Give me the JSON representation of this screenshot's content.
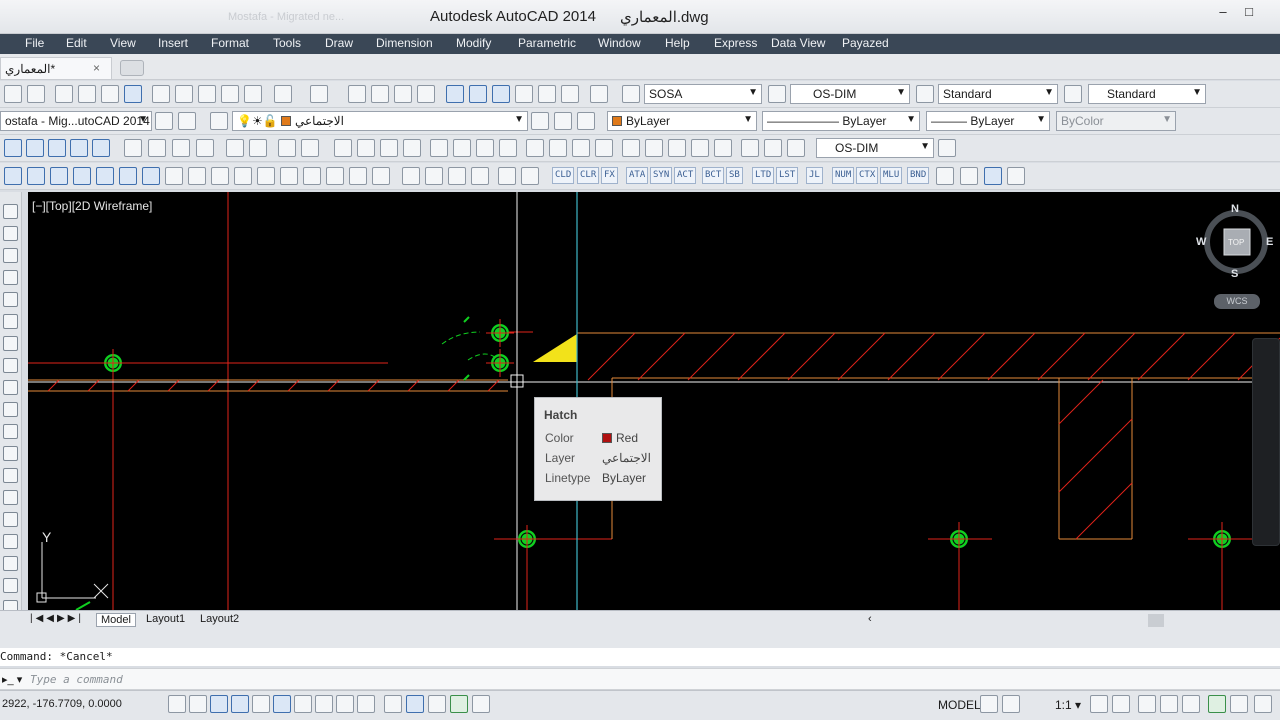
{
  "window": {
    "app_title": "Autodesk AutoCAD 2014",
    "file_name": "المعماري.dwg",
    "ghost_title": "Mostafa - Migrated ne...",
    "minimize": "–",
    "maximize": "□"
  },
  "menu": [
    "File",
    "Edit",
    "View",
    "Insert",
    "Format",
    "Tools",
    "Draw",
    "Dimension",
    "Modify",
    "Parametric",
    "Window",
    "Help",
    "Express",
    "Data View",
    "Payazed"
  ],
  "doc_tab": {
    "label": "المعماري*",
    "close": "×"
  },
  "styles": {
    "text_style": "SOSA",
    "dim_style": "OS-DIM",
    "table_style": "Standard",
    "multileader_style": "Standard",
    "dim_style_2": "OS-DIM"
  },
  "workspace": {
    "label": "ostafa - Mig...utoCAD 2014"
  },
  "layer": {
    "current": "الاجتماعي",
    "swatch_color": "#e07a1a"
  },
  "properties": {
    "color": "ByLayer",
    "color_swatch": "#e07a1a",
    "linetype": "ByLayer",
    "lineweight": "ByLayer",
    "plotstyle": "ByColor"
  },
  "express_chips": [
    "CLD",
    "CLR",
    "FX",
    "ATA",
    "SYN",
    "ACT",
    "BCT",
    "SB",
    "LTD",
    "LST",
    "JL",
    "NUM",
    "CTX",
    "MLU",
    "BND"
  ],
  "viewport": {
    "label": "[−][Top][2D Wireframe]"
  },
  "viewcube": {
    "north": "N",
    "south": "S",
    "east": "E",
    "west": "W",
    "top": "TOP",
    "wcs": "WCS"
  },
  "ucs": {
    "y": "Y"
  },
  "tooltip": {
    "title": "Hatch",
    "rows": [
      {
        "key": "Color",
        "value": "Red",
        "swatch": "#b01010"
      },
      {
        "key": "Layer",
        "value": "الاجتماعي"
      },
      {
        "key": "Linetype",
        "value": "ByLayer"
      }
    ]
  },
  "layout_tabs": [
    "Model",
    "Layout1",
    "Layout2"
  ],
  "command": {
    "history": "Command: *Cancel*",
    "placeholder": "Type a command"
  },
  "status": {
    "coords": "2922, -176.7709, 0.0000",
    "model": "MODEL",
    "scale": "1:1"
  },
  "colors": {
    "canvas": "#000000",
    "red_line": "#e0231a",
    "orange_line": "#e58a3a",
    "cyan_line": "#3fb8c8",
    "grip": "#10d020",
    "menubar": "#3a4756"
  }
}
